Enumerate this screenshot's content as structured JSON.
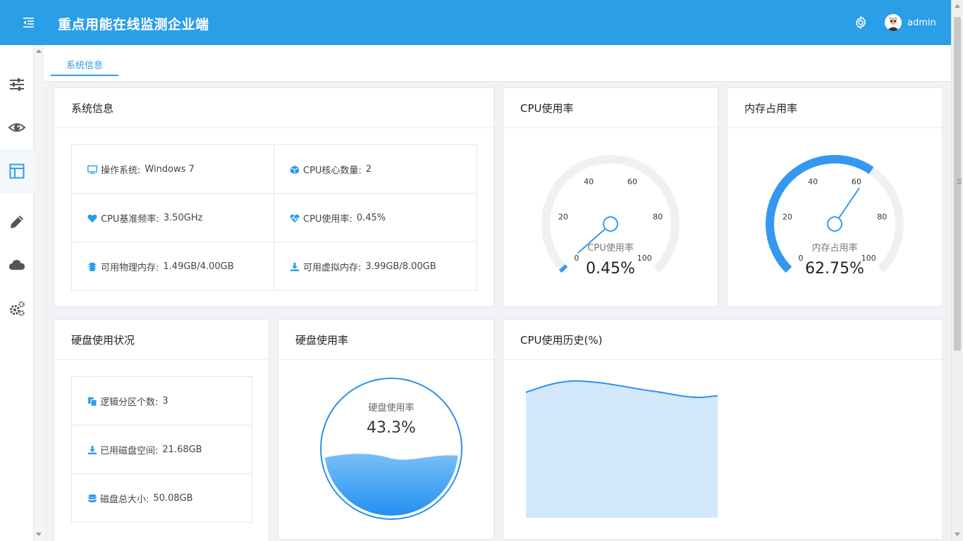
{
  "header": {
    "title": "重点用能在线监测企业端",
    "username": "admin"
  },
  "sidebar": {
    "items": [
      {
        "icon": "sliders-icon"
      },
      {
        "icon": "eye-icon"
      },
      {
        "icon": "layout-icon",
        "active": true
      },
      {
        "icon": "pencil-icon"
      },
      {
        "icon": "cloud-icon"
      },
      {
        "icon": "gears-icon"
      }
    ]
  },
  "tabs": [
    {
      "label": "系统信息",
      "active": true
    }
  ],
  "system_info": {
    "title": "系统信息",
    "items": [
      {
        "label": "操作系统:",
        "value": "Windows 7",
        "icon": "monitor-icon"
      },
      {
        "label": "CPU核心数量:",
        "value": "2",
        "icon": "cube-icon"
      },
      {
        "label": "CPU基准频率:",
        "value": "3.50GHz",
        "icon": "heart-icon"
      },
      {
        "label": "CPU使用率:",
        "value": "0.45%",
        "icon": "heartbeat-icon"
      },
      {
        "label": "可用物理内存:",
        "value": "1.49GB/4.00GB",
        "icon": "memory-chip-icon"
      },
      {
        "label": "可用虚拟内存:",
        "value": "3.99GB/8.00GB",
        "icon": "download-icon"
      }
    ]
  },
  "cpu_gauge": {
    "title": "CPU使用率",
    "label": "CPU使用率",
    "value_text": "0.45%",
    "value": 0.45,
    "ticks": [
      "0",
      "20",
      "40",
      "60",
      "80",
      "100"
    ]
  },
  "memory_gauge": {
    "title": "内存占用率",
    "label": "内存占用率",
    "value_text": "62.75%",
    "value": 62.75,
    "ticks": [
      "0",
      "20",
      "40",
      "60",
      "80",
      "100"
    ]
  },
  "disk_status": {
    "title": "硬盘使用状况",
    "items": [
      {
        "label": "逻辑分区个数:",
        "value": "3",
        "icon": "copy-icon"
      },
      {
        "label": "已用磁盘空间:",
        "value": "21.68GB",
        "icon": "download-icon"
      },
      {
        "label": "磁盘总大小:",
        "value": "50.08GB",
        "icon": "database-icon"
      }
    ]
  },
  "disk_usage": {
    "title": "硬盘使用率",
    "label": "硬盘使用率",
    "value_text": "43.3%",
    "value": 43.3
  },
  "cpu_history": {
    "title": "CPU使用历史(%)"
  },
  "colors": {
    "primary": "#2b9ee8",
    "gauge_fill": "#3399f0",
    "gauge_track": "#eef0f4",
    "area_fill": "#d4e8fb"
  }
}
